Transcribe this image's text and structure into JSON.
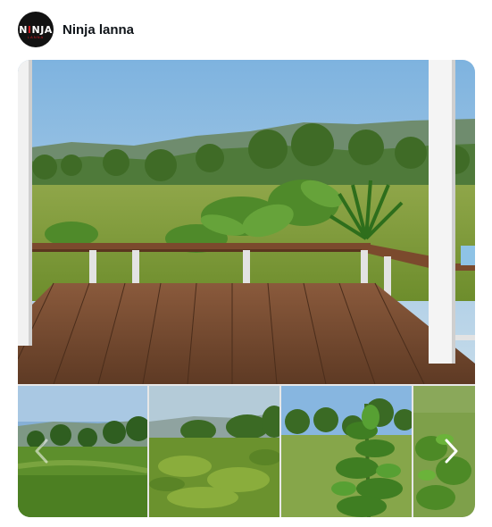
{
  "post": {
    "author": {
      "name": "Ninja lanna",
      "avatar_icon": "ninja-lanna-logo"
    }
  },
  "gallery": {
    "images": [
      {
        "alt": "wooden deck overlooking farmland and hills",
        "type": "main"
      },
      {
        "alt": "grass field with trees and hills",
        "type": "thumb"
      },
      {
        "alt": "overgrown field with banana plants",
        "type": "thumb"
      },
      {
        "alt": "young fruit tree in field",
        "type": "thumb"
      },
      {
        "alt": "plants in grassy field",
        "type": "thumb"
      }
    ],
    "controls": {
      "next_icon": "chevron-right-icon",
      "prev_icon": "chevron-left-icon"
    }
  }
}
